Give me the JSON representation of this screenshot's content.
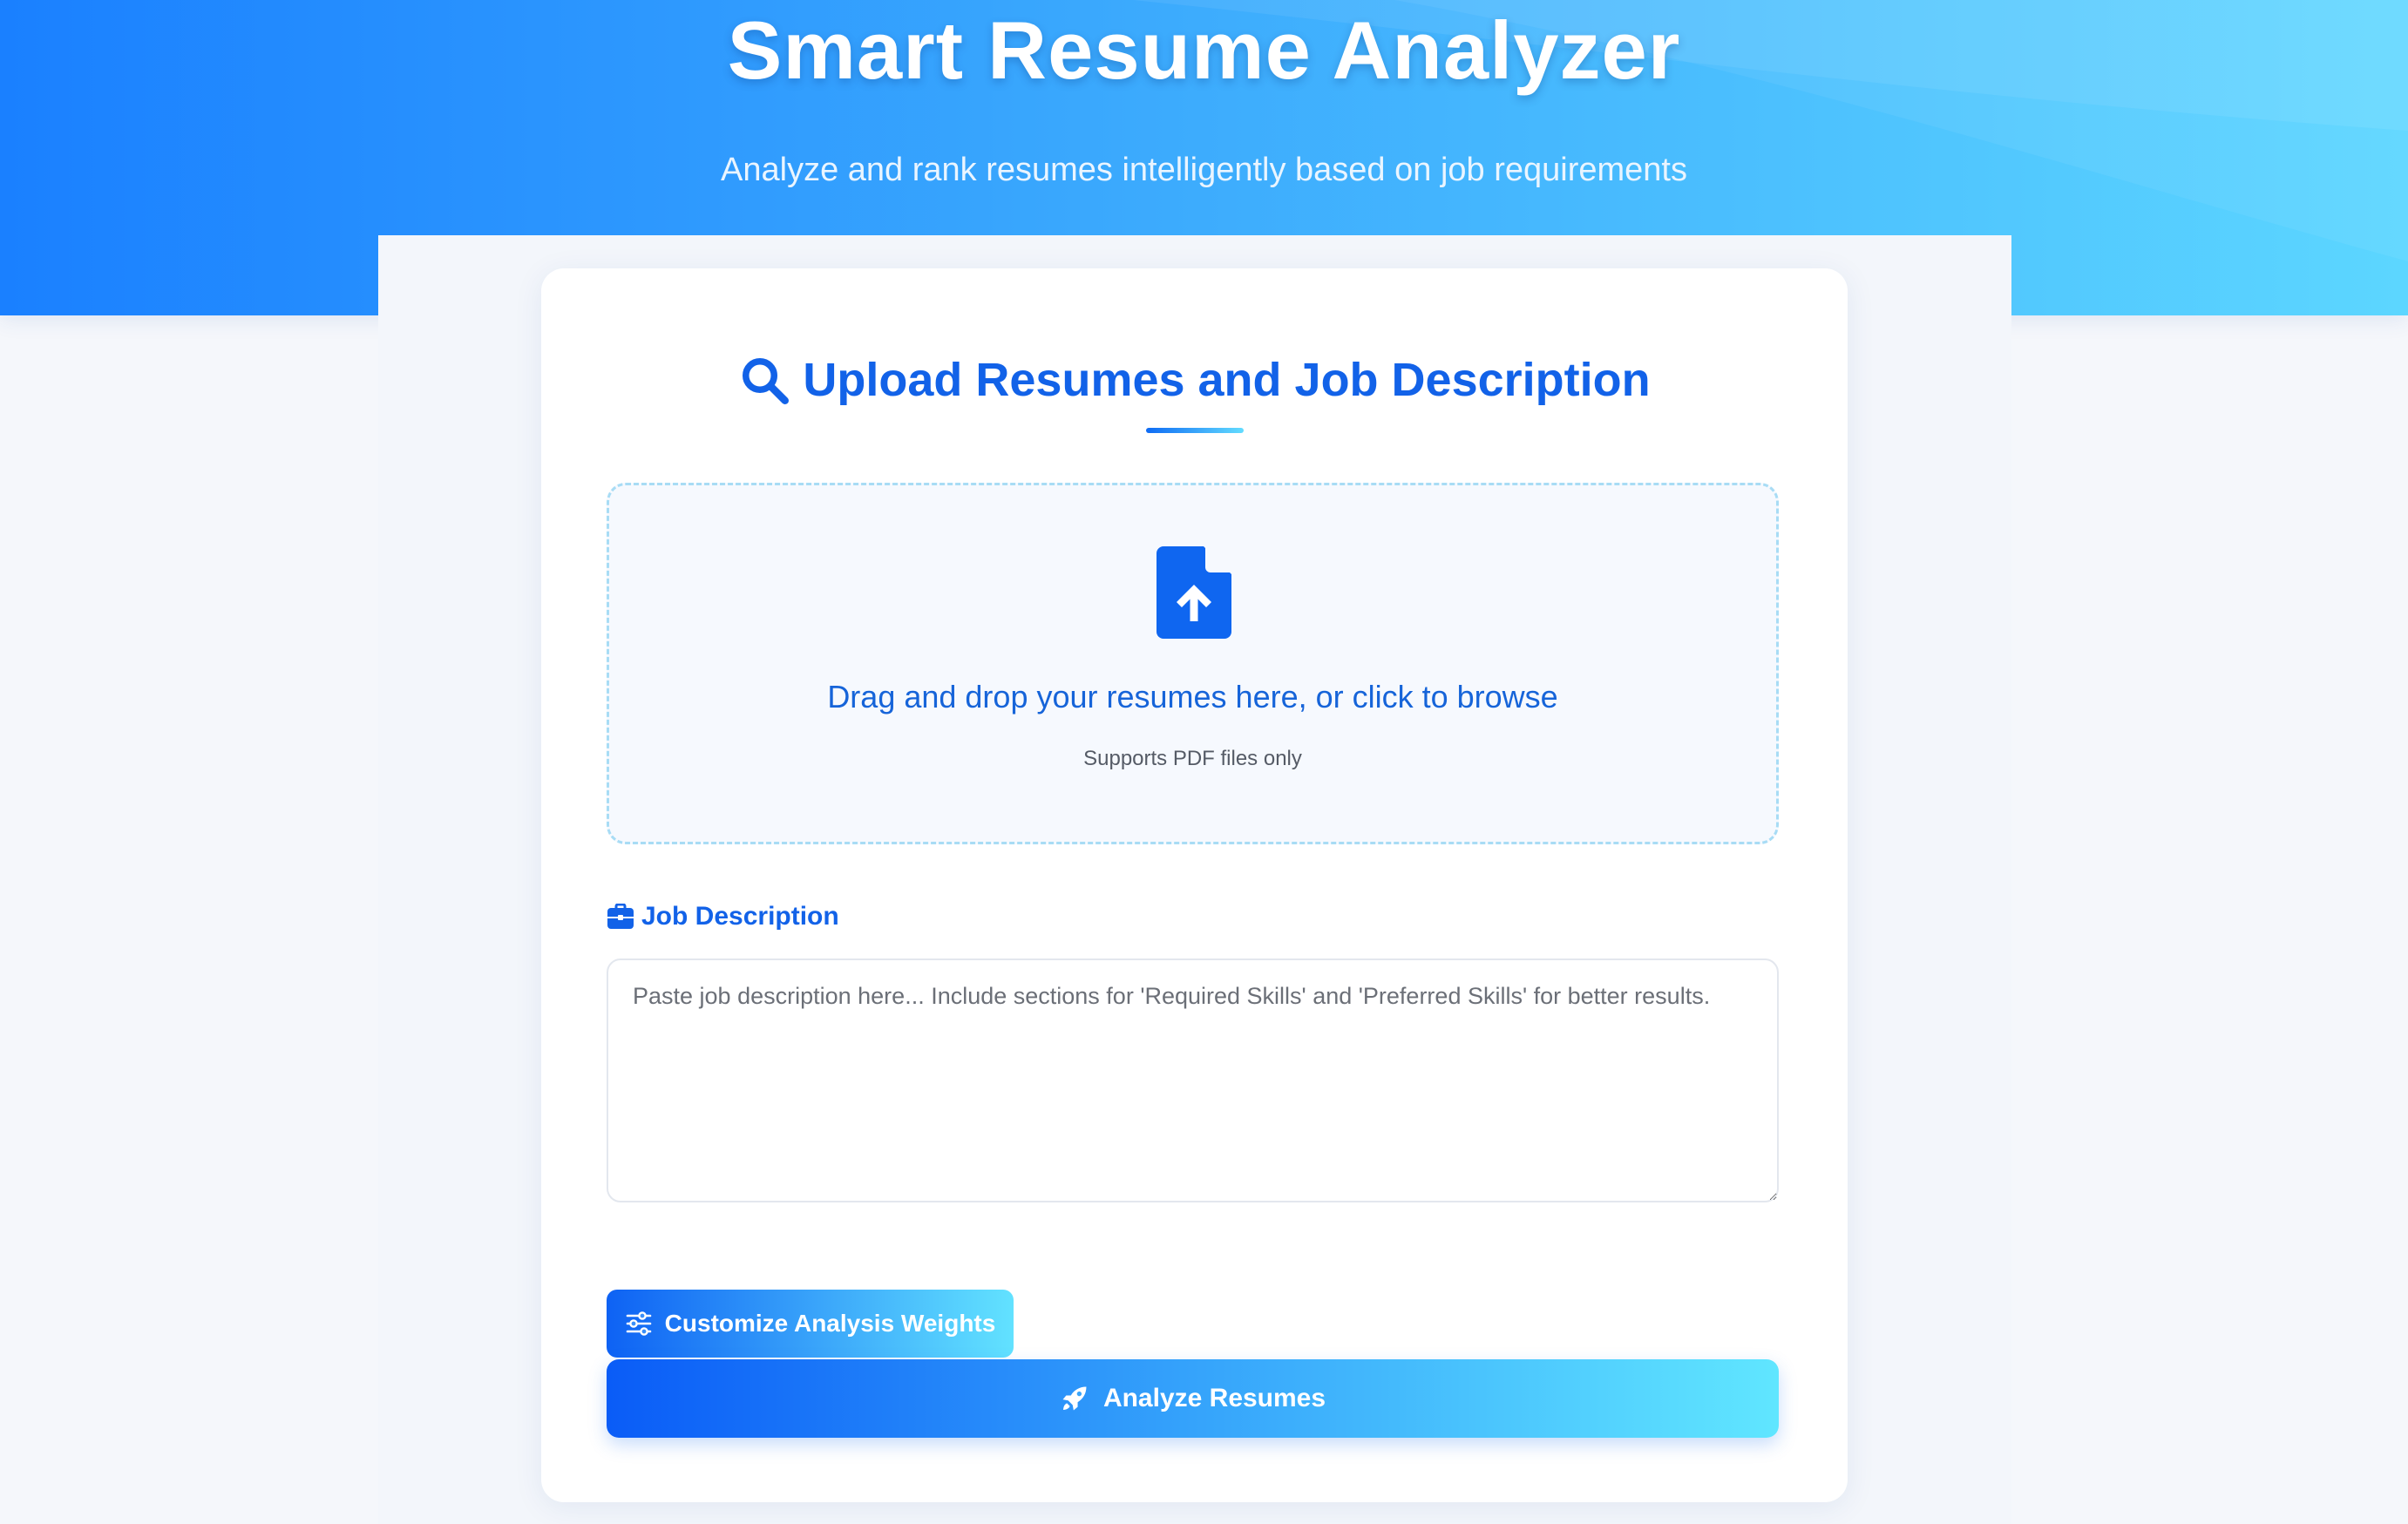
{
  "header": {
    "title": "Smart Resume Analyzer",
    "subtitle": "Analyze and rank resumes intelligently based on job requirements"
  },
  "upload_section": {
    "title": "Upload Resumes and Job Description",
    "title_icon": "search-icon",
    "dropzone": {
      "icon": "file-upload-icon",
      "text": "Drag and drop your resumes here, or click to browse",
      "hint": "Supports PDF files only"
    }
  },
  "job_description": {
    "label": "Job Description",
    "label_icon": "briefcase-icon",
    "value": "",
    "placeholder": "Paste job description here... Include sections for 'Required Skills' and 'Preferred Skills' for better results."
  },
  "actions": {
    "customize_weights_label": "Customize Analysis Weights",
    "customize_weights_icon": "sliders-icon",
    "analyze_label": "Analyze Resumes",
    "analyze_icon": "rocket-icon"
  },
  "colors": {
    "primary": "#1262e8",
    "gradient_start": "#1a80ff",
    "gradient_end": "#5cd6ff",
    "page_background": "#f5f7fb"
  }
}
